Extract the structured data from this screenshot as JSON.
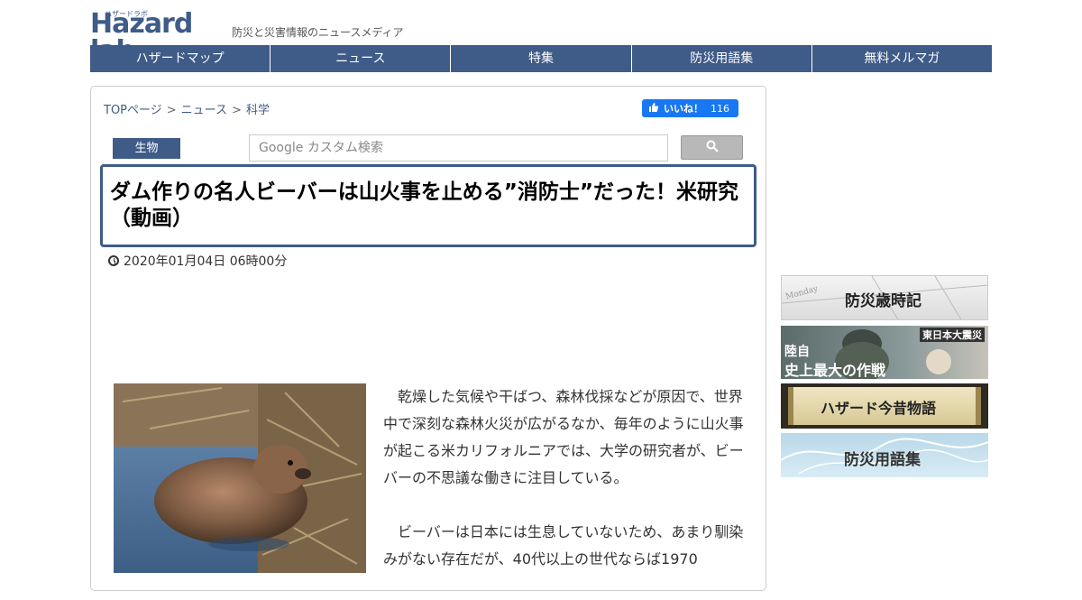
{
  "header": {
    "logo_text": "Hazard lab",
    "logo_ruby": "ハザードラボ",
    "tagline": "防災と災害情報のニュースメディア"
  },
  "nav": [
    "ハザードマップ",
    "ニュース",
    "特集",
    "防災用語集",
    "無料メルマガ"
  ],
  "breadcrumb": [
    "TOPページ",
    "ニュース",
    "科学"
  ],
  "breadcrumb_sep": ">",
  "facebook": {
    "label": "いいね！",
    "count": "116"
  },
  "category": "生物",
  "search": {
    "placeholder": "Google カスタム検索"
  },
  "article": {
    "title": "ダム作りの名人ビーバーは山火事を止める”消防士”だった！米研究（動画）",
    "date": "2020年01月04日 06時00分",
    "paragraphs": [
      "乾燥した気候や干ばつ、森林伐採などが原因で、世界中で深刻な森林火災が広がるなか、毎年のように山火事が起こる米カリフォルニアでは、大学の研究者が、ビーバーの不思議な働きに注目している。",
      "ビーバーは日本には生息していないため、あまり馴染みがない存在だが、40代以上の世代ならば1970"
    ]
  },
  "banners": {
    "b1": {
      "title": "防災歳時記",
      "bg_word": "Monday"
    },
    "b2": {
      "tag": "東日本大震災",
      "line1": "陸自",
      "line2": "史上最大の作戦"
    },
    "b3": {
      "title": "ハザード今昔物語"
    },
    "b4": {
      "title": "防災用語集"
    }
  },
  "colors": {
    "brand": "#3f5b88",
    "facebook": "#1877f2"
  }
}
